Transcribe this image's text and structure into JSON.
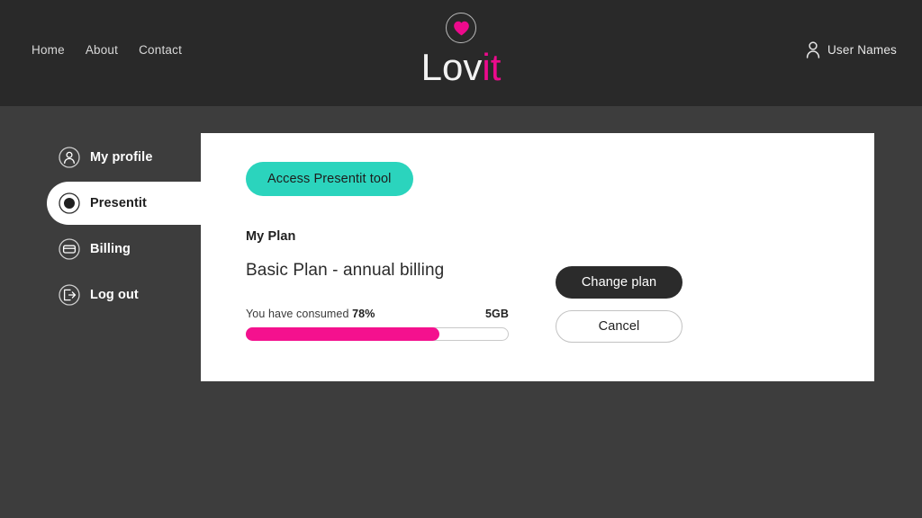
{
  "header": {
    "nav": [
      {
        "label": "Home",
        "name": "nav-link-home"
      },
      {
        "label": "About",
        "name": "nav-link-about"
      },
      {
        "label": "Contact",
        "name": "nav-link-contact"
      }
    ],
    "brand": {
      "name_primary": "Lov",
      "name_accent": "it",
      "mark_icon": "heart-icon",
      "accent_color": "#ec0a8c"
    },
    "user": {
      "icon": "user-icon",
      "label": "User Names"
    },
    "background_color": "#292929"
  },
  "sidebar": {
    "items": [
      {
        "label": "My profile",
        "icon": "user-circle-icon",
        "active": false
      },
      {
        "label": "Presentit",
        "icon": "radio-filled-icon",
        "active": true
      },
      {
        "label": "Billing",
        "icon": "credit-card-circle-icon",
        "active": false
      },
      {
        "label": "Log out",
        "icon": "logout-circle-icon",
        "active": false
      }
    ]
  },
  "card": {
    "access_button": {
      "label": "Access Presentit tool",
      "color": "#2bd4bd"
    },
    "plan_heading": "My Plan",
    "plan_name": "Basic Plan - annual billing",
    "usage": {
      "label": "You have consumed",
      "percent": "78%",
      "capacity": "5GB",
      "fill_color": "#f4118e",
      "fill_width": "74%"
    },
    "actions": {
      "primary_label": "Change plan",
      "secondary_label": "Cancel"
    }
  },
  "page": {
    "background_color": "#3d3d3d"
  }
}
